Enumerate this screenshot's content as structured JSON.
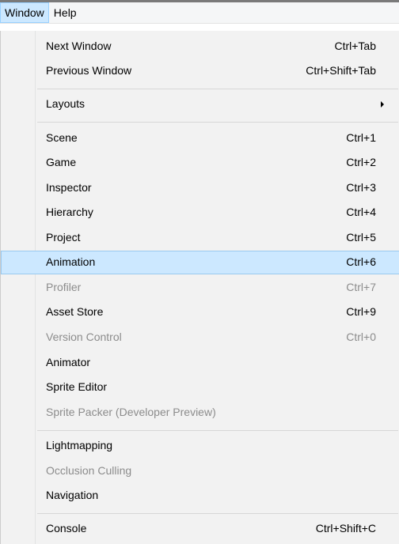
{
  "menubar": {
    "items": [
      {
        "label": "Window"
      },
      {
        "label": "Help"
      }
    ]
  },
  "menu": {
    "items": [
      {
        "label": "Next Window",
        "shortcut": "Ctrl+Tab",
        "enabled": true
      },
      {
        "label": "Previous Window",
        "shortcut": "Ctrl+Shift+Tab",
        "enabled": true
      },
      {
        "label": "Layouts",
        "shortcut": "",
        "enabled": true,
        "submenu": true
      },
      {
        "label": "Scene",
        "shortcut": "Ctrl+1",
        "enabled": true
      },
      {
        "label": "Game",
        "shortcut": "Ctrl+2",
        "enabled": true
      },
      {
        "label": "Inspector",
        "shortcut": "Ctrl+3",
        "enabled": true
      },
      {
        "label": "Hierarchy",
        "shortcut": "Ctrl+4",
        "enabled": true
      },
      {
        "label": "Project",
        "shortcut": "Ctrl+5",
        "enabled": true
      },
      {
        "label": "Animation",
        "shortcut": "Ctrl+6",
        "enabled": true,
        "highlighted": true
      },
      {
        "label": "Profiler",
        "shortcut": "Ctrl+7",
        "enabled": false
      },
      {
        "label": "Asset Store",
        "shortcut": "Ctrl+9",
        "enabled": true
      },
      {
        "label": "Version Control",
        "shortcut": "Ctrl+0",
        "enabled": false
      },
      {
        "label": "Animator",
        "shortcut": "",
        "enabled": true
      },
      {
        "label": "Sprite Editor",
        "shortcut": "",
        "enabled": true
      },
      {
        "label": "Sprite Packer (Developer Preview)",
        "shortcut": "",
        "enabled": false
      },
      {
        "label": "Lightmapping",
        "shortcut": "",
        "enabled": true
      },
      {
        "label": "Occlusion Culling",
        "shortcut": "",
        "enabled": false
      },
      {
        "label": "Navigation",
        "shortcut": "",
        "enabled": true
      },
      {
        "label": "Console",
        "shortcut": "Ctrl+Shift+C",
        "enabled": true
      }
    ]
  },
  "colors": {
    "highlight_bg": "#cce8ff",
    "highlight_border": "#99c9ef",
    "disabled_text": "#8c8c8c",
    "menu_bg": "#f2f2f2"
  }
}
